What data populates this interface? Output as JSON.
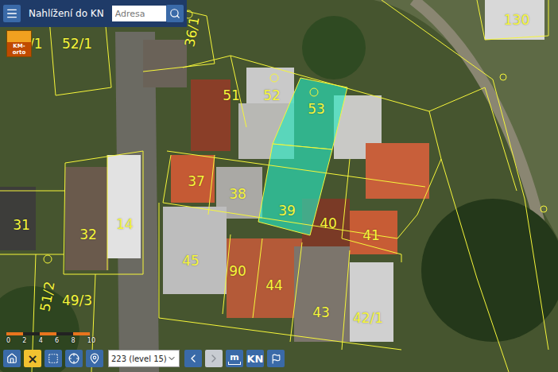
{
  "header": {
    "title": "Nahlížení do KN",
    "search": {
      "placeholder": "Adresa"
    }
  },
  "layer_toggle": {
    "label": "KM-orto"
  },
  "parcels": [
    {
      "label": "0/1",
      "selected": false
    },
    {
      "label": "52/1",
      "selected": false
    },
    {
      "label": "36/1",
      "selected": false
    },
    {
      "label": "130",
      "selected": false
    },
    {
      "label": "51",
      "selected": false
    },
    {
      "label": "52",
      "selected": false
    },
    {
      "label": "53",
      "selected": true
    },
    {
      "label": "37",
      "selected": false
    },
    {
      "label": "38",
      "selected": false
    },
    {
      "label": "39",
      "selected": true
    },
    {
      "label": "40",
      "selected": false
    },
    {
      "label": "41",
      "selected": false
    },
    {
      "label": "31",
      "selected": false
    },
    {
      "label": "32",
      "selected": false
    },
    {
      "label": "14",
      "selected": false
    },
    {
      "label": "45",
      "selected": false
    },
    {
      "label": "90",
      "selected": false
    },
    {
      "label": "44",
      "selected": false
    },
    {
      "label": "43",
      "selected": false
    },
    {
      "label": "42/1",
      "selected": false
    },
    {
      "label": "51/2",
      "selected": false
    },
    {
      "label": "49/3",
      "selected": false
    }
  ],
  "scale": {
    "ticks": [
      "0",
      "2",
      "4",
      "6",
      "8",
      "10"
    ]
  },
  "toolbar": {
    "clear": {
      "label": "×",
      "selected": true
    },
    "zoom": {
      "value": "223 (level 15)"
    },
    "prev_disabled": false,
    "next_disabled": true,
    "measure": {
      "label": "m"
    },
    "kn": {
      "label": "KN"
    }
  }
}
